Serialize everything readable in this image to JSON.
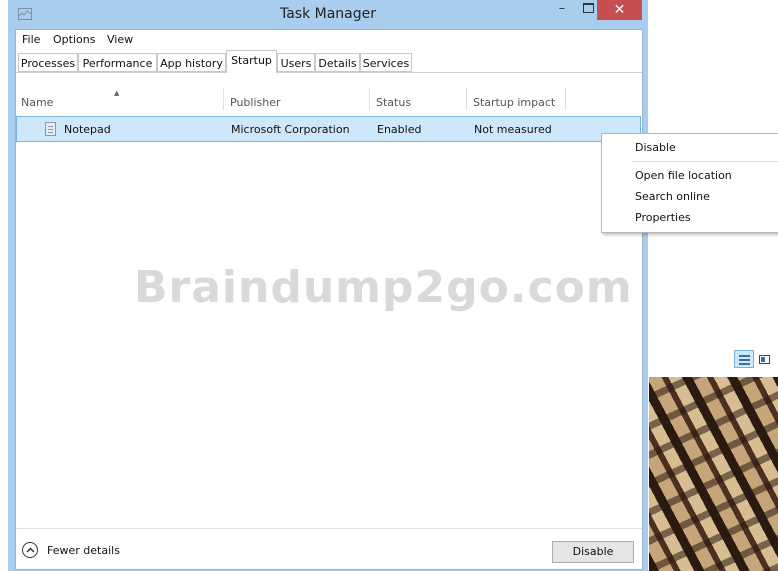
{
  "window": {
    "title": "Task Manager",
    "minimize_glyph": "–",
    "close_glyph": "✕"
  },
  "menu": [
    "File",
    "Options",
    "View"
  ],
  "tabs": [
    {
      "label": "Processes",
      "active": false
    },
    {
      "label": "Performance",
      "active": false
    },
    {
      "label": "App history",
      "active": false
    },
    {
      "label": "Startup",
      "active": true
    },
    {
      "label": "Users",
      "active": false
    },
    {
      "label": "Details",
      "active": false
    },
    {
      "label": "Services",
      "active": false
    }
  ],
  "table": {
    "columns": [
      "Name",
      "Publisher",
      "Status",
      "Startup impact"
    ],
    "rows": [
      {
        "name": "Notepad",
        "publisher": "Microsoft Corporation",
        "status": "Enabled",
        "impact": "Not measured",
        "icon": "notepad-icon"
      }
    ]
  },
  "watermark": "Braindump2go.com",
  "footer": {
    "fewer_details": "Fewer details",
    "disable_button": "Disable"
  },
  "context_menu": {
    "items": [
      "Disable",
      "Open file location",
      "Search online",
      "Properties"
    ]
  },
  "colors": {
    "title_bar": "#a8cdef",
    "close_button": "#c74f4f",
    "selection": "#cde8fb",
    "selection_border": "#7db4dd"
  }
}
